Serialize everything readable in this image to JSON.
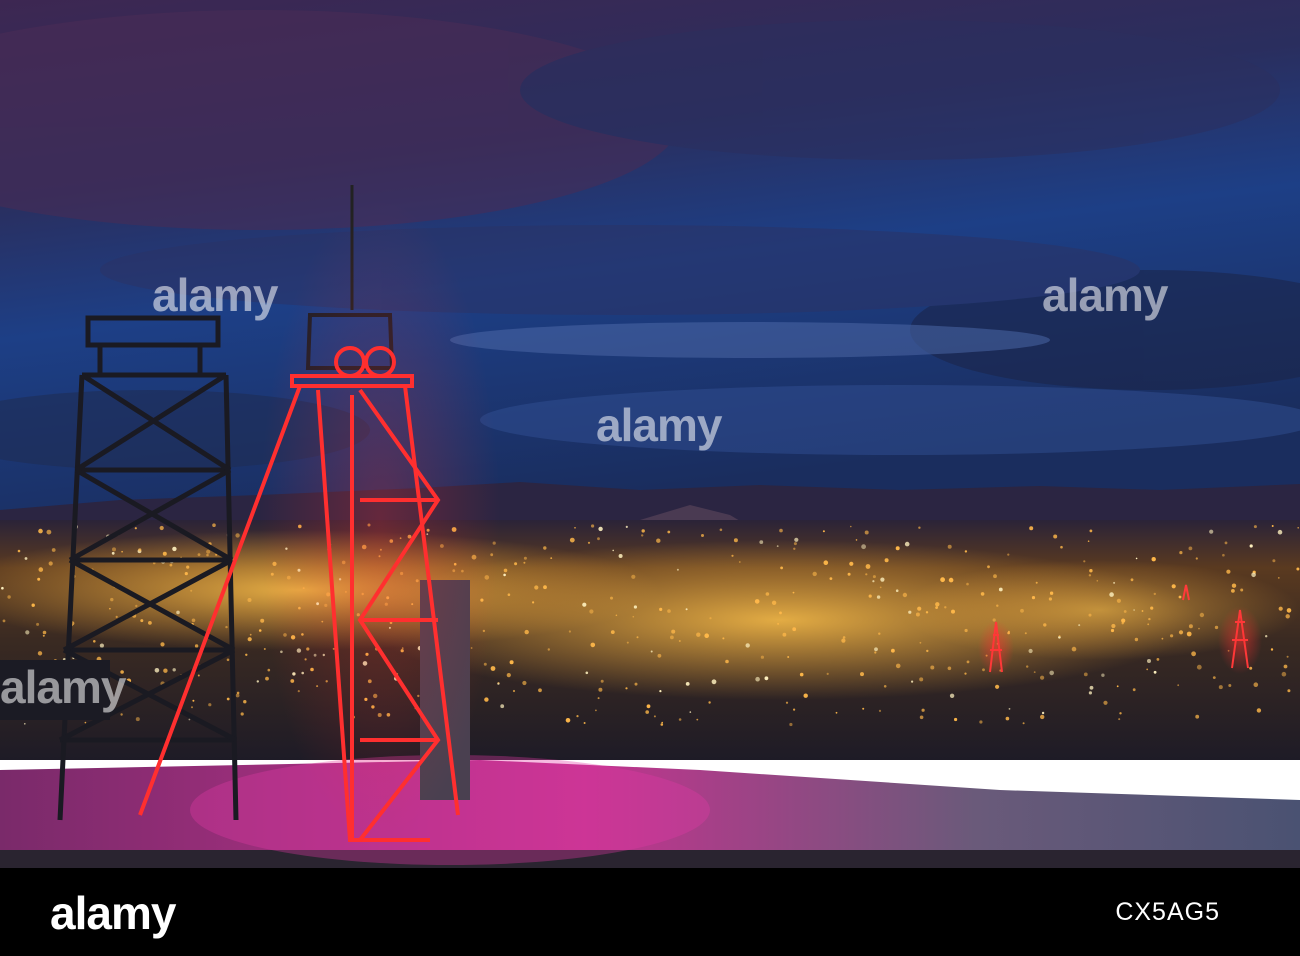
{
  "watermark": {
    "text": "alamy"
  },
  "footer": {
    "logo": "alamy",
    "image_code": "CX5AG5"
  },
  "colors": {
    "sky_top": "#3a2a5a",
    "sky_blue": "#1d3a7a",
    "neon_red": "#ff2a2a",
    "city_lights": "#ffb03a",
    "snow_pink": "#c8338f"
  }
}
